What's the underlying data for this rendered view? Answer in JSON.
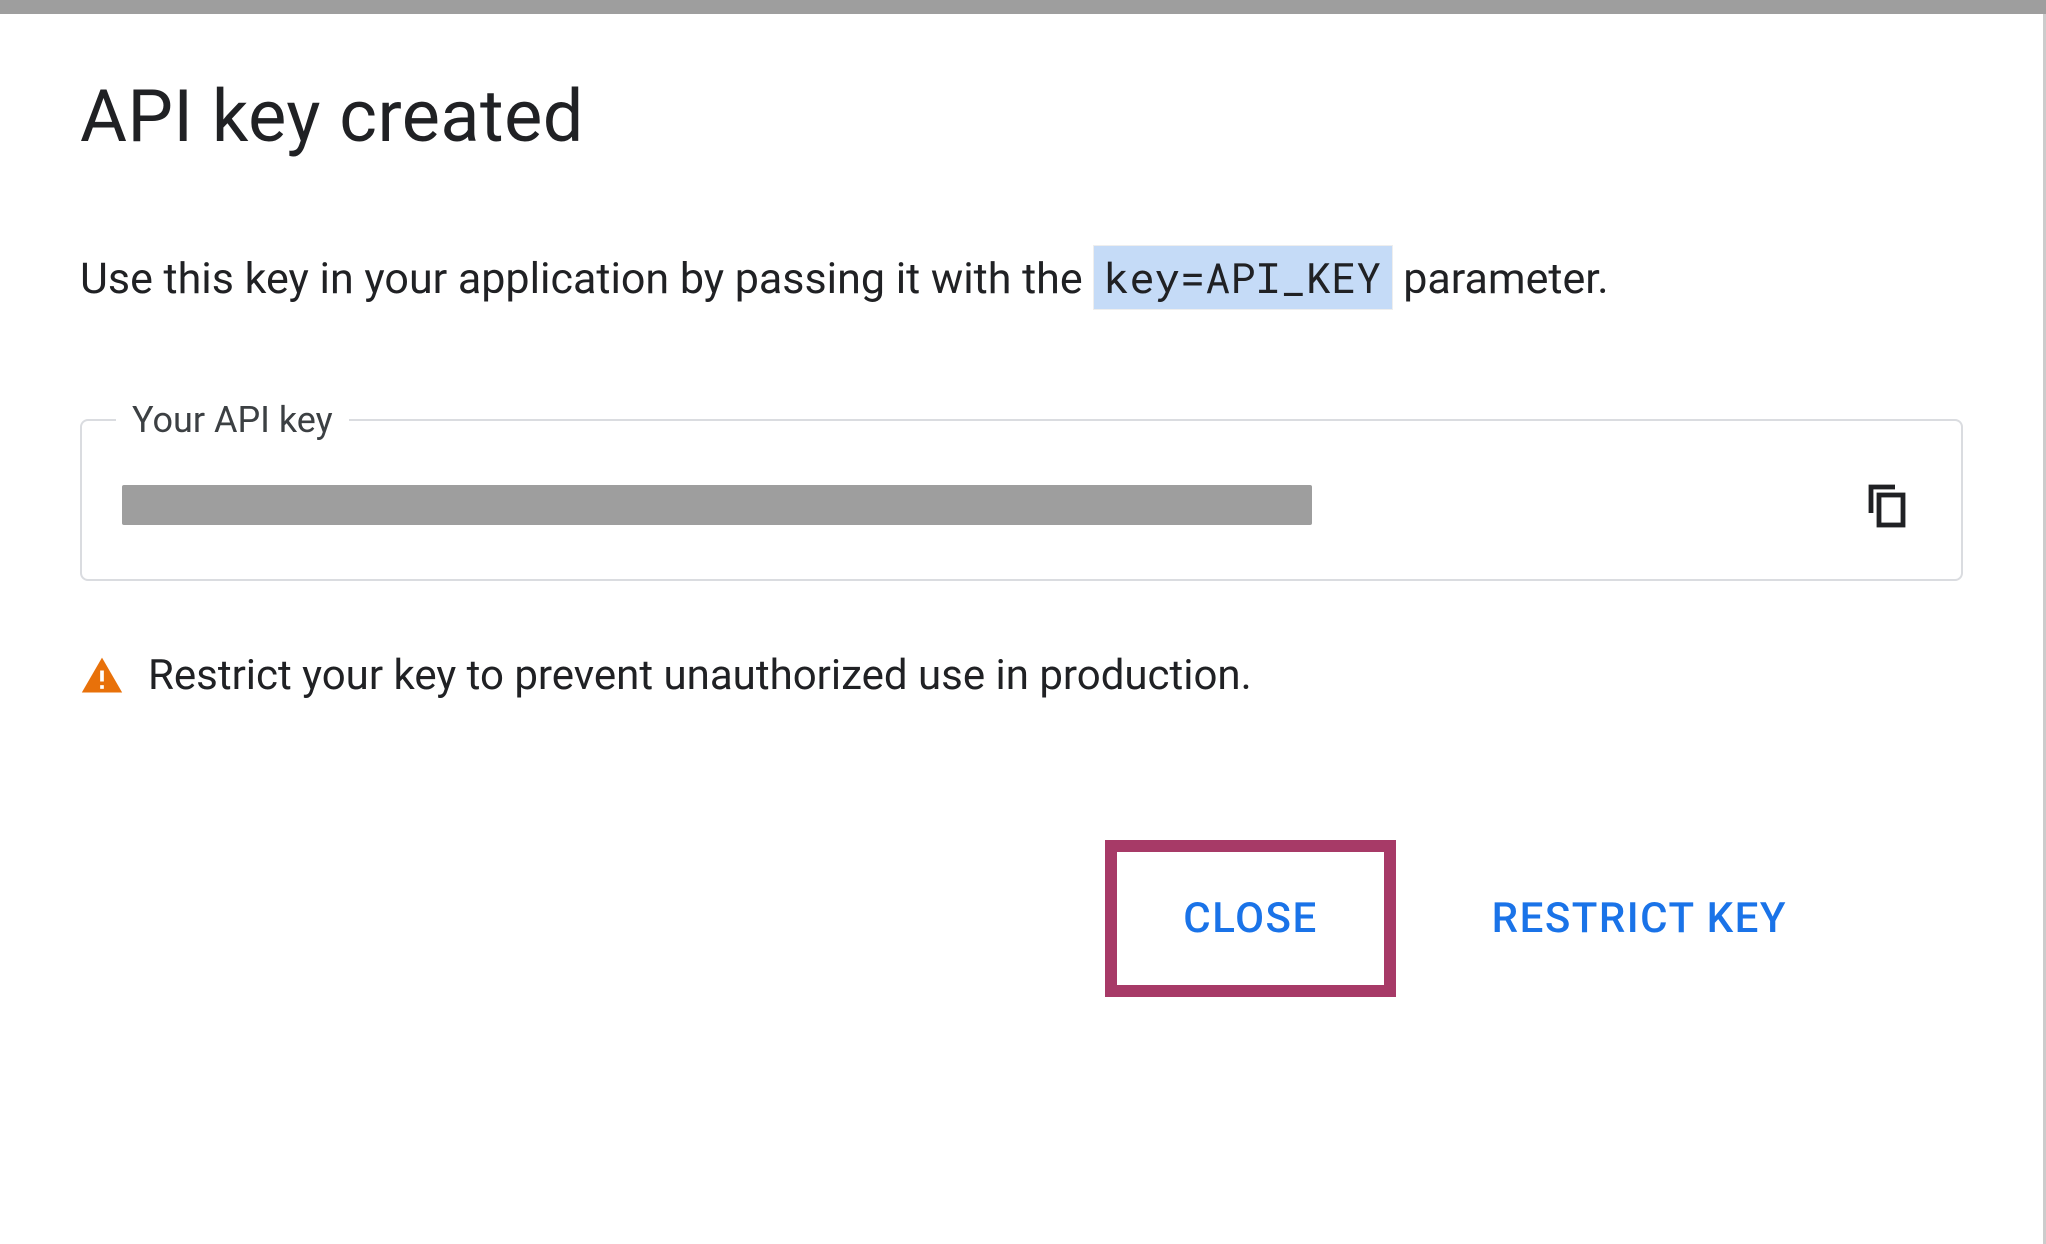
{
  "dialog": {
    "title": "API key created",
    "description_prefix": "Use this key in your application by passing it with the ",
    "code_snippet": "key=API_KEY",
    "description_suffix": " parameter."
  },
  "apiKeyField": {
    "legend": "Your API key",
    "value_masked": true,
    "copy_icon": "copy"
  },
  "warning": {
    "icon": "warning",
    "text": "Restrict your key to prevent unauthorized use in production."
  },
  "buttons": {
    "close": "CLOSE",
    "restrict": "RESTRICT KEY"
  },
  "colors": {
    "primary": "#1a73e8",
    "warning": "#e8710a",
    "highlight_border": "#a73a67",
    "code_bg": "#c5dbf7"
  }
}
